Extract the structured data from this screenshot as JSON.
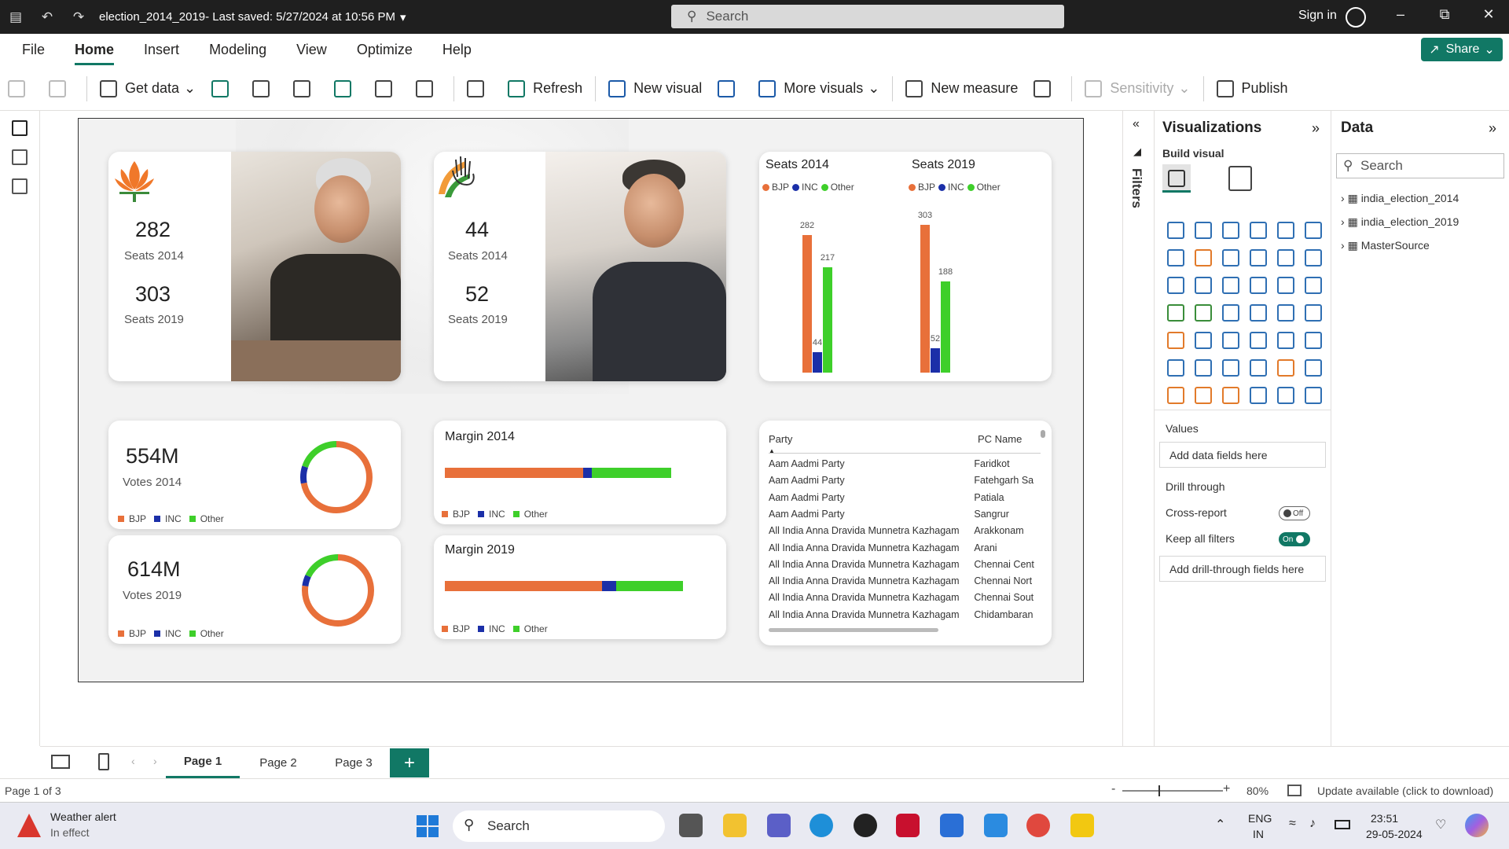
{
  "titlebar": {
    "filename": "election_2014_2019",
    "saved": " - Last saved: 5/27/2024 at 10:56 PM",
    "search_placeholder": "Search",
    "signin": "Sign in"
  },
  "menu": {
    "items": [
      "File",
      "Home",
      "Insert",
      "Modeling",
      "View",
      "Optimize",
      "Help"
    ],
    "share": "Share"
  },
  "ribbon": {
    "get_data": "Get data",
    "refresh": "Refresh",
    "new_visual": "New visual",
    "more_visuals": "More visuals",
    "new_measure": "New measure",
    "sensitivity": "Sensitivity",
    "publish": "Publish"
  },
  "colors": {
    "bjp": "#e8703a",
    "inc": "#1b2fa8",
    "other": "#3ecf2a",
    "accent": "#117865"
  },
  "report": {
    "bjp_card": {
      "seats_2014": "282",
      "label_2014": "Seats 2014",
      "seats_2019": "303",
      "label_2019": "Seats 2019"
    },
    "inc_card": {
      "seats_2014": "44",
      "label_2014": "Seats 2014",
      "seats_2019": "52",
      "label_2019": "Seats 2019"
    },
    "votes_2014": {
      "value": "554M",
      "label": "Votes 2014"
    },
    "votes_2019": {
      "value": "614M",
      "label": "Votes 2019"
    },
    "margin_2014": {
      "title": "Margin 2014"
    },
    "margin_2019": {
      "title": "Margin 2019"
    },
    "legend": {
      "bjp": "BJP",
      "inc": "INC",
      "other": "Other"
    },
    "table": {
      "headers": [
        "Party",
        "PC Name"
      ],
      "rows": [
        [
          "Aam Aadmi Party",
          "Faridkot"
        ],
        [
          "Aam Aadmi Party",
          "Fatehgarh Sa"
        ],
        [
          "Aam Aadmi Party",
          "Patiala"
        ],
        [
          "Aam Aadmi Party",
          "Sangrur"
        ],
        [
          "All India Anna Dravida Munnetra Kazhagam",
          "Arakkonam"
        ],
        [
          "All India Anna Dravida Munnetra Kazhagam",
          "Arani"
        ],
        [
          "All India Anna Dravida Munnetra Kazhagam",
          "Chennai Cent"
        ],
        [
          "All India Anna Dravida Munnetra Kazhagam",
          "Chennai Nort"
        ],
        [
          "All India Anna Dravida Munnetra Kazhagam",
          "Chennai Sout"
        ],
        [
          "All India Anna Dravida Munnetra Kazhagam",
          "Chidambaran"
        ]
      ]
    }
  },
  "chart_data": [
    {
      "type": "bar",
      "title": "Seats 2014",
      "categories": [
        "BJP",
        "INC",
        "Other"
      ],
      "values": [
        282,
        44,
        217
      ],
      "ylim": [
        0,
        303
      ]
    },
    {
      "type": "bar",
      "title": "Seats 2019",
      "categories": [
        "BJP",
        "INC",
        "Other"
      ],
      "values": [
        303,
        52,
        188
      ],
      "ylim": [
        0,
        303
      ]
    },
    {
      "type": "pie",
      "title": "Votes 2014",
      "categories": [
        "BJP",
        "INC",
        "Other"
      ],
      "values": [
        0.72,
        0.08,
        0.2
      ]
    },
    {
      "type": "pie",
      "title": "Votes 2019",
      "categories": [
        "BJP",
        "INC",
        "Other"
      ],
      "values": [
        0.77,
        0.05,
        0.18
      ]
    },
    {
      "type": "bar",
      "title": "Margin 2014",
      "categories": [
        "BJP",
        "INC",
        "Other"
      ],
      "values": [
        0.61,
        0.04,
        0.35
      ]
    },
    {
      "type": "bar",
      "title": "Margin 2019",
      "categories": [
        "BJP",
        "INC",
        "Other"
      ],
      "values": [
        0.66,
        0.06,
        0.28
      ]
    }
  ],
  "viz_pane": {
    "title": "Visualizations",
    "build": "Build visual",
    "values": "Values",
    "add_data": "Add data fields here",
    "drill": "Drill through",
    "cross": "Cross-report",
    "cross_state": "Off",
    "keep": "Keep all filters",
    "keep_state": "On",
    "add_drill": "Add drill-through fields here"
  },
  "filters": "Filters",
  "data_pane": {
    "title": "Data",
    "search": "Search",
    "tables": [
      "india_election_2014",
      "india_election_2019",
      "MasterSource"
    ]
  },
  "pages": {
    "tabs": [
      "Page 1",
      "Page 2",
      "Page 3"
    ],
    "add": "+"
  },
  "status": {
    "page": "Page 1 of 3",
    "zoom": "80%",
    "update": "Update available (click to download)"
  },
  "taskbar": {
    "weather_title": "Weather alert",
    "weather_sub": "In effect",
    "search": "Search",
    "lang1": "ENG",
    "lang2": "IN",
    "time": "23:51",
    "date": "29-05-2024"
  }
}
